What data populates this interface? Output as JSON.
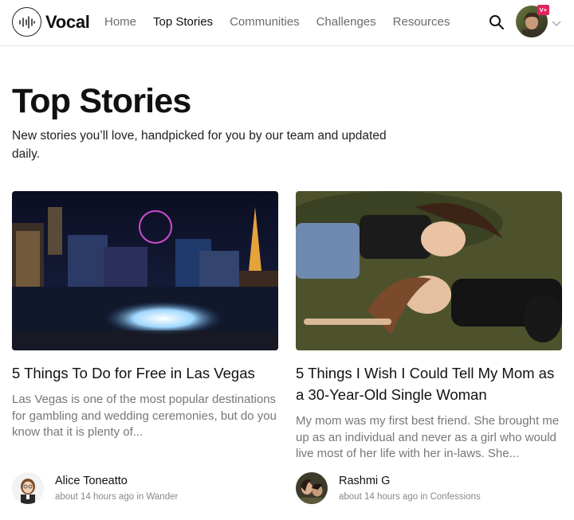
{
  "brand": {
    "name": "Vocal",
    "icon": "vocal-soundwave-icon"
  },
  "nav": {
    "links": [
      {
        "label": "Home",
        "active": false
      },
      {
        "label": "Top Stories",
        "active": true
      },
      {
        "label": "Communities",
        "active": false
      },
      {
        "label": "Challenges",
        "active": false
      },
      {
        "label": "Resources",
        "active": false
      }
    ],
    "search_icon": "search-icon",
    "user": {
      "badge": "V+",
      "menu_icon": "chevron-down-icon"
    }
  },
  "header": {
    "title": "Top Stories",
    "subtitle": "New stories you’ll love, handpicked for you by our team and updated daily."
  },
  "stories": [
    {
      "title": "5 Things To Do for Free in Las Vegas",
      "excerpt": "Las Vegas is one of the most popular destinations for gambling and wedding ceremonies, but do you know that it is plenty of...",
      "author": "Alice Toneatto",
      "time": "about 14 hours ago",
      "in_word": "in",
      "community": "Wander"
    },
    {
      "title": "5 Things I Wish I Could Tell My Mom as a 30-Year-Old Single Woman",
      "excerpt": "My mom was my first best friend. She brought me up as an individual and never as a girl who would live most of her life with her in-laws. She...",
      "author": "Rashmi G",
      "time": "about 14 hours ago",
      "in_word": "in",
      "community": "Confessions"
    }
  ],
  "colors": {
    "text": "#111111",
    "muted": "#777777",
    "badge": "#e0245e",
    "border": "#e5e5e5"
  }
}
